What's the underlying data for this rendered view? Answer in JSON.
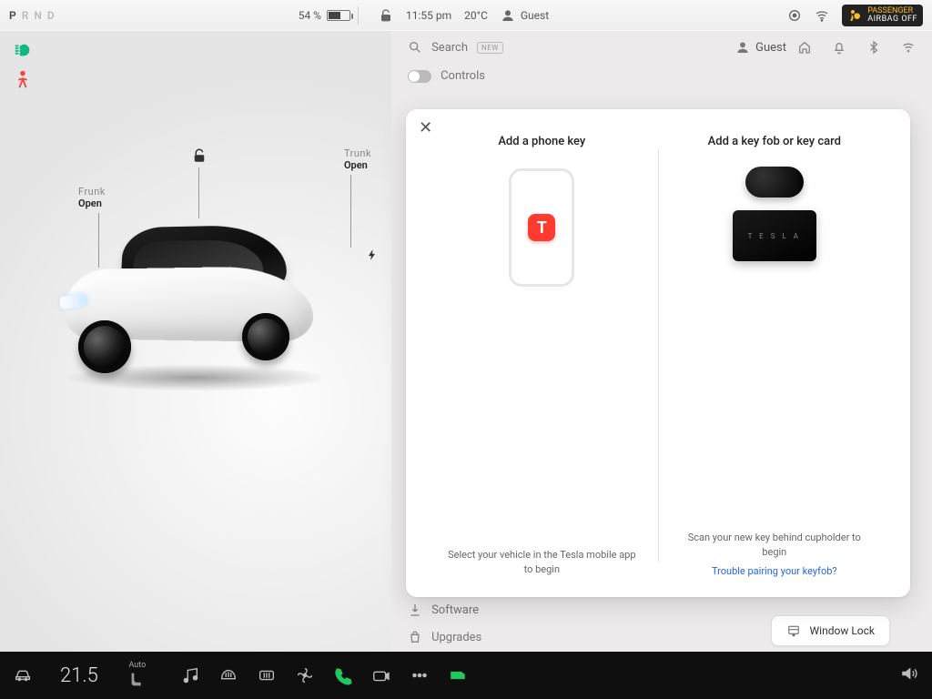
{
  "status": {
    "gear_options": [
      "P",
      "R",
      "N",
      "D"
    ],
    "gear_selected": "P",
    "battery_pct": 54,
    "battery_label": "54 %",
    "time": "11:55 pm",
    "temp_out": "20°C",
    "profile": "Guest",
    "airbag_line1": "PASSENGER",
    "airbag_line2": "AIRBAG OFF"
  },
  "vehicle_panel": {
    "frunk": {
      "label": "Frunk",
      "state": "Open"
    },
    "trunk": {
      "label": "Trunk",
      "state": "Open"
    },
    "locked": false
  },
  "settings": {
    "search_label": "Search",
    "search_badge": "NEW",
    "profile_chip": "Guest",
    "controls_label": "Controls",
    "list": [
      {
        "icon": "download",
        "label": "Software"
      },
      {
        "icon": "bag",
        "label": "Upgrades"
      }
    ],
    "window_lock_label": "Window Lock"
  },
  "modal": {
    "phone": {
      "title": "Add a phone key",
      "desc": "Select your vehicle in the Tesla mobile app to begin"
    },
    "fob": {
      "title": "Add a key fob or key card",
      "card_text": "T E S L A",
      "desc": "Scan your new key behind cupholder to begin",
      "help_link": "Trouble pairing your keyfob?"
    }
  },
  "dock": {
    "cabin_temp": "21.5",
    "seat_mode": "Auto"
  }
}
